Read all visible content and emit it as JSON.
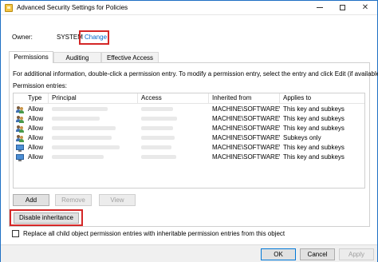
{
  "window": {
    "title": "Advanced Security Settings for Policies"
  },
  "owner": {
    "label": "Owner:",
    "value": "SYSTEM",
    "change_link": "Change"
  },
  "tabs": [
    {
      "label": "Permissions",
      "active": true
    },
    {
      "label": "Auditing",
      "active": false
    },
    {
      "label": "Effective Access",
      "active": false
    }
  ],
  "panel": {
    "info_text": "For additional information, double-click a permission entry. To modify a permission entry, select the entry and click Edit (if available).",
    "entries_label": "Permission entries:"
  },
  "list": {
    "columns": [
      "Type",
      "Principal",
      "Access",
      "Inherited from",
      "Applies to"
    ],
    "rows": [
      {
        "icon": "users-icon",
        "type": "Allow",
        "inherited": "MACHINE\\SOFTWARE\\...",
        "applies": "This key and subkeys"
      },
      {
        "icon": "users-icon",
        "type": "Allow",
        "inherited": "MACHINE\\SOFTWARE\\...",
        "applies": "This key and subkeys"
      },
      {
        "icon": "users-icon",
        "type": "Allow",
        "inherited": "MACHINE\\SOFTWARE\\...",
        "applies": "This key and subkeys"
      },
      {
        "icon": "users-icon",
        "type": "Allow",
        "inherited": "MACHINE\\SOFTWARE\\...",
        "applies": "Subkeys only"
      },
      {
        "icon": "computer-icon",
        "type": "Allow",
        "inherited": "MACHINE\\SOFTWARE\\...",
        "applies": "This key and subkeys"
      },
      {
        "icon": "computer-icon",
        "type": "Allow",
        "inherited": "MACHINE\\SOFTWARE\\...",
        "applies": "This key and subkeys"
      }
    ]
  },
  "buttons": {
    "add": "Add",
    "remove": "Remove",
    "view": "View",
    "disable_inheritance": "Disable inheritance"
  },
  "replace_checkbox": {
    "label": "Replace all child object permission entries with inheritable permission entries from this object",
    "checked": false
  },
  "footer": {
    "ok": "OK",
    "cancel": "Cancel",
    "apply": "Apply"
  },
  "colors": {
    "highlight": "#d42727",
    "link": "#0066cc",
    "window_border": "#1e6fc4"
  }
}
